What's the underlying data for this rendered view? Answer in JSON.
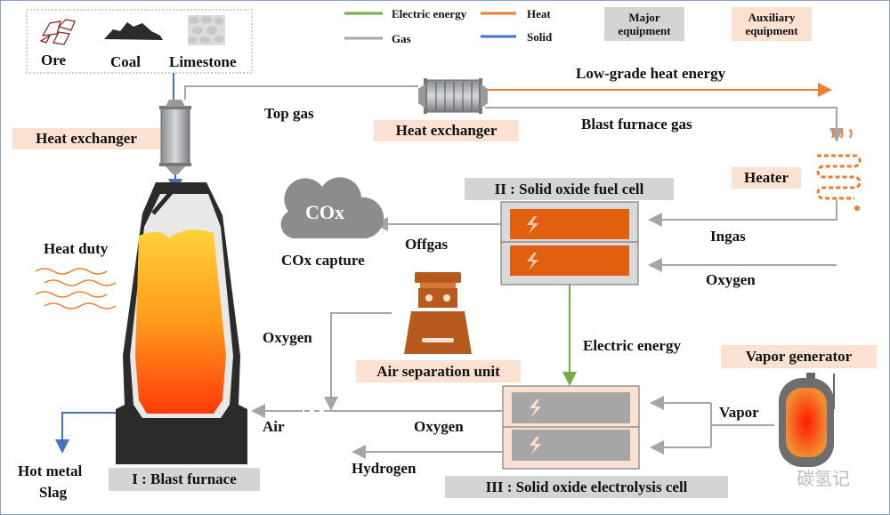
{
  "legend": {
    "electric_energy": "Electric energy",
    "heat": "Heat",
    "gas": "Gas",
    "solid": "Solid",
    "major_equipment": "Major equipment",
    "auxiliary_equipment": "Auxiliary equipment"
  },
  "colors": {
    "electric": "#70ad47",
    "heat": "#ed7d31",
    "gas": "#a6a6a6",
    "solid": "#4472c4",
    "major": "#d4d4d4",
    "auxiliary": "#fbe1d2"
  },
  "raw_materials": [
    "Ore",
    "Coal",
    "Limestone"
  ],
  "equipment": {
    "heat_exchanger_1": "Heat exchanger",
    "heat_exchanger_2": "Heat exchanger",
    "heater": "Heater",
    "sofc": "II : Solid oxide fuel cell",
    "soec": "III : Solid oxide electrolysis cell",
    "asu": "Air separation unit",
    "vapor_generator": "Vapor generator",
    "blast_furnace": "I : Blast furnace",
    "co_capture": "COx capture",
    "co_cloud_text": "COx"
  },
  "flows": {
    "top_gas": "Top gas",
    "low_grade_heat": "Low-grade heat energy",
    "bf_gas": "Blast furnace gas",
    "ingas": "Ingas",
    "oxygen_sofc": "Oxygen",
    "offgas": "Offgas",
    "electric_energy": "Electric energy",
    "vapor": "Vapor",
    "oxygen_soec": "Oxygen",
    "oxygen_asu": "Oxygen",
    "air": "Air",
    "hydrogen": "Hydrogen",
    "heat_duty": "Heat duty",
    "hot_metal": "Hot metal",
    "slag": "Slag"
  },
  "watermark": "碳氢记"
}
